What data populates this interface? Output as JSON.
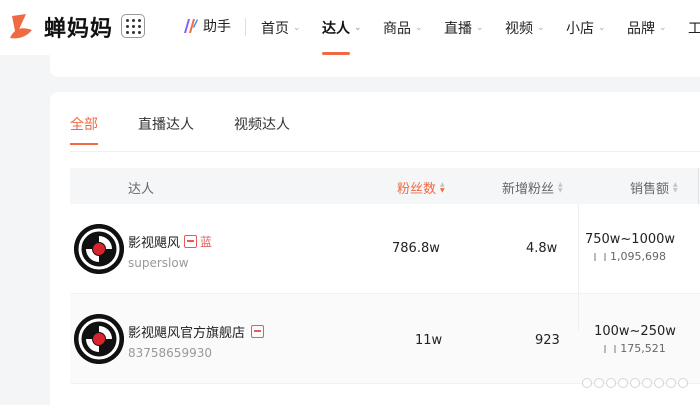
{
  "brand": {
    "name": "蝉妈妈",
    "color": "#ef6a43"
  },
  "nav": {
    "assistant": "助手",
    "items": [
      {
        "label": "首页",
        "chev": "⌄"
      },
      {
        "label": "达人",
        "chev": "⌄"
      },
      {
        "label": "商品",
        "chev": "⌄"
      },
      {
        "label": "直播",
        "chev": "⌄"
      },
      {
        "label": "视频",
        "chev": "⌄"
      },
      {
        "label": "小店",
        "chev": "⌄"
      },
      {
        "label": "品牌",
        "chev": "⌄"
      },
      {
        "label": "工"
      }
    ],
    "active_index": 1
  },
  "tabs": [
    "全部",
    "直播达人",
    "视频达人"
  ],
  "active_tab": 0,
  "table": {
    "headers": {
      "influencer": "达人",
      "fans": "粉丝数",
      "new_fans": "新增粉丝",
      "sales": "销售额"
    },
    "rows": [
      {
        "name": "影视飓风",
        "tag": "蓝",
        "sub": "superslow",
        "fans": "786.8w",
        "new_fans": "4.8w",
        "sales_range": "750w~1000w",
        "sales_count": "1,095,698"
      },
      {
        "name": "影视飓风官方旗舰店",
        "sub": "83758659930",
        "fans": "11w",
        "new_fans": "923",
        "sales_range": "100w~250w",
        "sales_count": "175,521"
      }
    ]
  }
}
